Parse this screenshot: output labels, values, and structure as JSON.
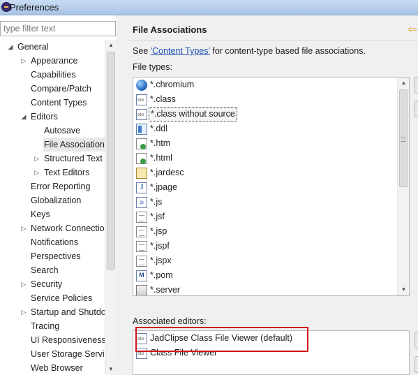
{
  "window": {
    "title": "Preferences"
  },
  "left": {
    "filter_placeholder": "type filter text",
    "tree": [
      {
        "label": "General",
        "level": 0,
        "state": "open"
      },
      {
        "label": "Appearance",
        "level": 1,
        "state": "closed"
      },
      {
        "label": "Capabilities",
        "level": 1,
        "state": "leaf"
      },
      {
        "label": "Compare/Patch",
        "level": 1,
        "state": "leaf"
      },
      {
        "label": "Content Types",
        "level": 1,
        "state": "leaf"
      },
      {
        "label": "Editors",
        "level": 1,
        "state": "open"
      },
      {
        "label": "Autosave",
        "level": 2,
        "state": "leaf"
      },
      {
        "label": "File Associations",
        "level": 2,
        "state": "leaf",
        "selected": true
      },
      {
        "label": "Structured Text Editors",
        "level": 2,
        "state": "closed"
      },
      {
        "label": "Text Editors",
        "level": 2,
        "state": "closed"
      },
      {
        "label": "Error Reporting",
        "level": 1,
        "state": "leaf"
      },
      {
        "label": "Globalization",
        "level": 1,
        "state": "leaf"
      },
      {
        "label": "Keys",
        "level": 1,
        "state": "leaf"
      },
      {
        "label": "Network Connections",
        "level": 1,
        "state": "closed"
      },
      {
        "label": "Notifications",
        "level": 1,
        "state": "leaf"
      },
      {
        "label": "Perspectives",
        "level": 1,
        "state": "leaf"
      },
      {
        "label": "Search",
        "level": 1,
        "state": "leaf"
      },
      {
        "label": "Security",
        "level": 1,
        "state": "closed"
      },
      {
        "label": "Service Policies",
        "level": 1,
        "state": "leaf"
      },
      {
        "label": "Startup and Shutdown",
        "level": 1,
        "state": "closed"
      },
      {
        "label": "Tracing",
        "level": 1,
        "state": "leaf"
      },
      {
        "label": "UI Responsiveness",
        "level": 1,
        "state": "leaf"
      },
      {
        "label": "User Storage Service",
        "level": 1,
        "state": "leaf"
      },
      {
        "label": "Web Browser",
        "level": 1,
        "state": "leaf"
      }
    ]
  },
  "main": {
    "page_title": "File Associations",
    "see_prefix": "See ",
    "see_link": "'Content Types'",
    "see_suffix": " for content-type based file associations.",
    "file_types_label": "File types:",
    "file_types": [
      {
        "name": "*.chromium",
        "icon": "globe-icon"
      },
      {
        "name": "*.class",
        "icon": "class-file-icon"
      },
      {
        "name": "*.class without source",
        "icon": "class-file-icon",
        "focused": true
      },
      {
        "name": "*.ddl",
        "icon": "ddl-file-icon"
      },
      {
        "name": "*.htm",
        "icon": "web-page-icon"
      },
      {
        "name": "*.html",
        "icon": "web-page-icon"
      },
      {
        "name": "*.jardesc",
        "icon": "jar-description-icon"
      },
      {
        "name": "*.jpage",
        "icon": "java-page-icon"
      },
      {
        "name": "*.js",
        "icon": "javascript-file-icon"
      },
      {
        "name": "*.jsf",
        "icon": "text-file-icon"
      },
      {
        "name": "*.jsp",
        "icon": "text-file-icon"
      },
      {
        "name": "*.jspf",
        "icon": "text-file-icon"
      },
      {
        "name": "*.jspx",
        "icon": "text-file-icon"
      },
      {
        "name": "*.pom",
        "icon": "maven-pom-icon"
      },
      {
        "name": "*.server",
        "icon": "server-file-icon"
      }
    ],
    "associated_label": "Associated editors:",
    "associated_editors": [
      {
        "name": "JadClipse Class File Viewer (default)",
        "icon": "class-file-icon"
      },
      {
        "name": "Class File Viewer",
        "icon": "class-file-icon"
      }
    ],
    "highlight_color": "#d0121b",
    "link_color": "#1a4fb4"
  }
}
